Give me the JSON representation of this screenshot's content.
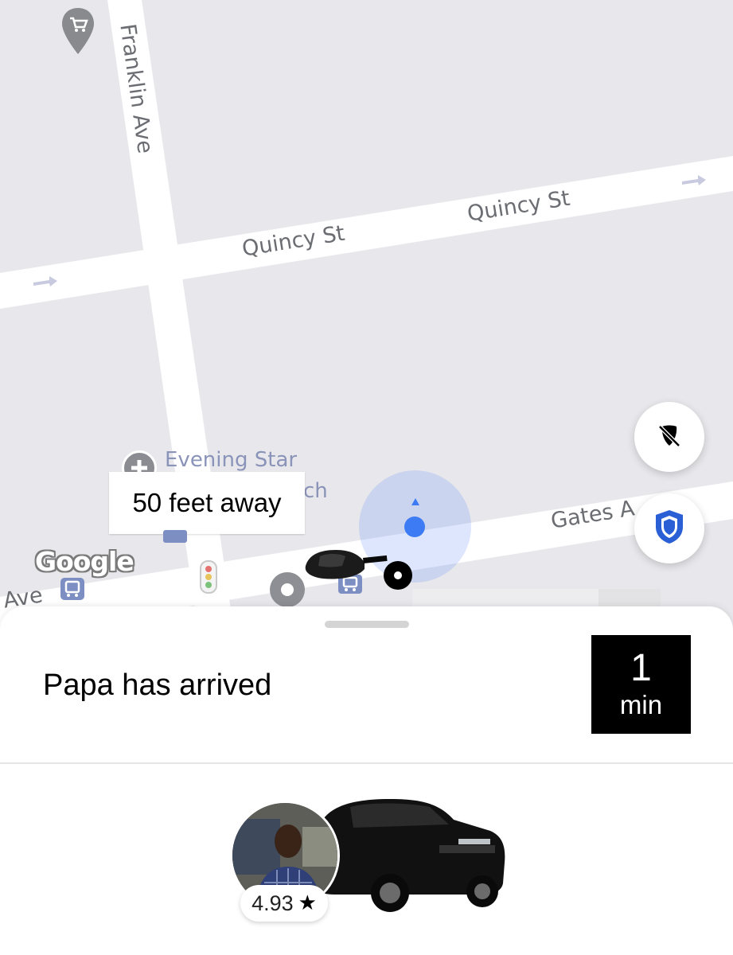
{
  "map": {
    "streets": {
      "franklin": "Franklin Ave",
      "quincy_left": "Quincy St",
      "quincy_right": "Quincy St",
      "gates": "Gates A",
      "ave_partial": "Ave"
    },
    "poi": {
      "evening_star": "Evening Star",
      "church_fragment": "ch"
    },
    "distance_label": "50 feet away",
    "attribution": "Google",
    "icons": [
      "shopping-cart-icon",
      "hospital-plus-icon",
      "bus-stop-icon",
      "traffic-light-icon",
      "location-pin-icon",
      "car-icon",
      "pickup-dot-icon",
      "user-location-icon",
      "hide-location-icon",
      "safety-shield-icon"
    ]
  },
  "trip": {
    "status": "Papa has arrived",
    "eta_value": "1",
    "eta_unit": "min"
  },
  "driver": {
    "rating": "4.93",
    "rating_icon": "star-icon"
  },
  "colors": {
    "accent_blue": "#3d7bf5",
    "shield_blue": "#2a5fd6",
    "map_bg": "#e8e8ec",
    "road": "#ffffff"
  }
}
